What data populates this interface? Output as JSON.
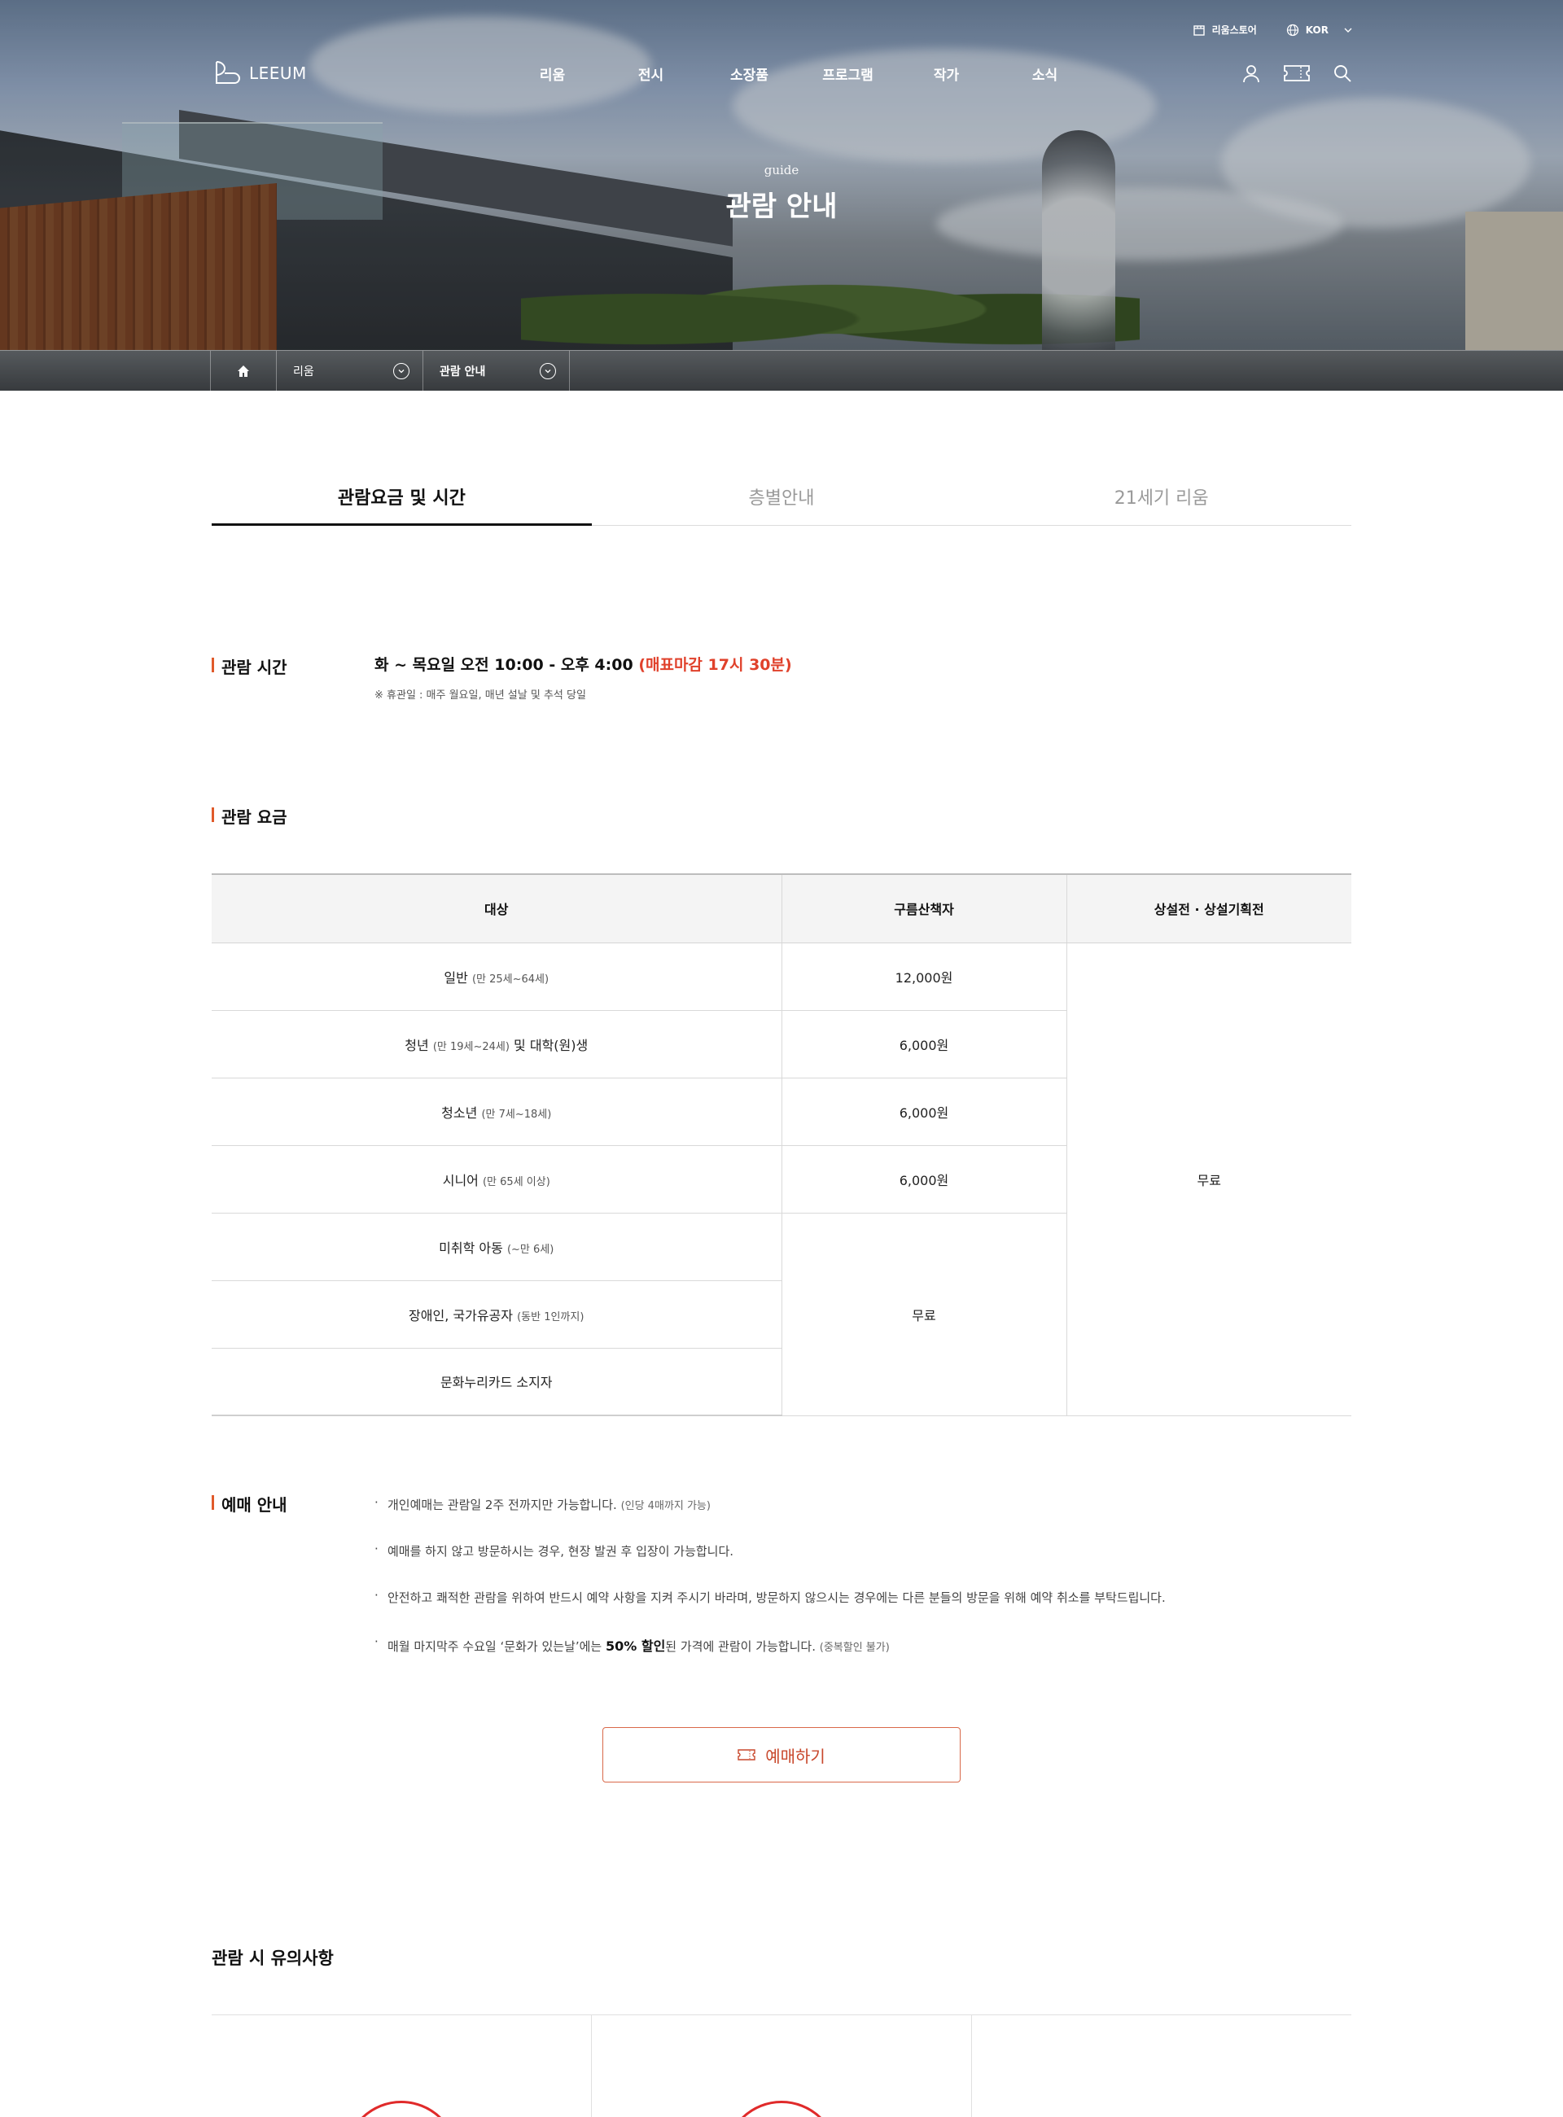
{
  "header": {
    "store_label": "리움스토어",
    "lang_label": "KOR",
    "logo_text": "LEEUM",
    "menu": [
      "리움",
      "전시",
      "소장품",
      "프로그램",
      "작가",
      "소식"
    ]
  },
  "hero": {
    "subtitle": "guide",
    "title": "관람 안내"
  },
  "breadcrumb": {
    "level1": "리움",
    "level2": "관람 안내"
  },
  "tabs": [
    "관람요금 및 시간",
    "층별안내",
    "21세기 리움"
  ],
  "hours": {
    "label": "관람 시간",
    "main": "화 ~ 목요일 오전 10:00 - 오후 4:00 ",
    "deadline": "(매표마감 17시 30분)",
    "note": "※ 휴관일 : 매주 월요일, 매년 설날 및 추석 당일"
  },
  "fee": {
    "label": "관람 요금",
    "headers": [
      "대상",
      "구름산책자",
      "상설전 · 상설기획전"
    ],
    "rows": [
      {
        "name": "일반",
        "sub": "(만 25세~64세)",
        "price": "12,000원"
      },
      {
        "name": "청년",
        "sub": "(만 19세~24세)",
        "name2": " 및 대학(원)생",
        "price": "6,000원"
      },
      {
        "name": "청소년",
        "sub": "(만 7세~18세)",
        "price": "6,000원"
      },
      {
        "name": "시니어",
        "sub": "(만 65세 이상)",
        "price": "6,000원"
      },
      {
        "name": "미취학 아동",
        "sub": "(~만 6세)"
      },
      {
        "name": "장애인, 국가유공자",
        "sub": "(동반 1인까지)"
      },
      {
        "name": "문화누리카드 소지자",
        "sub": ""
      }
    ],
    "free_cloud": "무료",
    "free_permanent": "무료"
  },
  "reservation": {
    "label": "예매 안내",
    "items": [
      {
        "text": "개인예매는 관람일 2주 전까지만 가능합니다. ",
        "note": "(인당 4매까지 가능)"
      },
      {
        "text": "예매를 하지 않고 방문하시는 경우, 현장 발권 후 입장이 가능합니다."
      },
      {
        "text": "안전하고 쾌적한 관람을 위하여 반드시 예약 사항을 지켜 주시기 바라며, 방문하지 않으시는 경우에는 다른 분들의 방문을 위해 예약 취소를 부탁드립니다."
      },
      {
        "pre": "매월 마지막주 수요일 ‘문화가 있는날’에는 ",
        "bold": "50% 할인",
        "post": "된 가격에 관람이 가능합니다. ",
        "note": "(중복할인 불가)"
      }
    ],
    "button_label": "예매하기"
  },
  "cautions": {
    "title": "관람 시 유의사항"
  },
  "colors": {
    "accent": "#e05a2b",
    "deadline_red": "#e0412b",
    "button_red": "#c8472b"
  }
}
